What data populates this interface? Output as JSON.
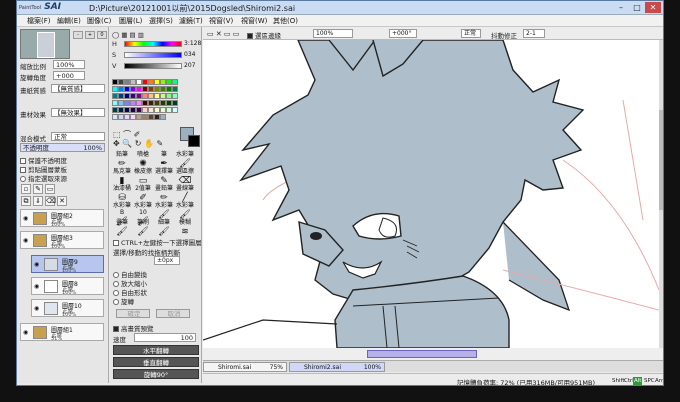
{
  "app": {
    "logo": "SAI",
    "logo_sub": "PaintTool",
    "title": "D:\\Picture\\20121001以前\\2015Dogsled\\Shiromi2.sai"
  },
  "window_controls": {
    "minimize": "–",
    "maximize": "□",
    "close": "✕"
  },
  "menu": [
    "檔案(F)",
    "編輯(E)",
    "圖像(C)",
    "圖層(L)",
    "選擇(S)",
    "濾鏡(T)",
    "視窗(V)",
    "視窗(W)",
    "其他(O)"
  ],
  "navigator": {
    "zoom_label": "縮放比例",
    "zoom_value": "100%",
    "angle_label": "旋轉角度",
    "angle_value": "+000",
    "btn_minus": "-",
    "btn_plus": "+",
    "btn_reset": "0"
  },
  "paper_texture": {
    "label": "畫紙質感",
    "value": "【無質感】"
  },
  "material_effect": {
    "label": "畫材效果",
    "value": "【無效果】"
  },
  "blend_mode": {
    "label": "混合模式",
    "value": "正常"
  },
  "opacity": {
    "label": "不透明度",
    "value": "100%"
  },
  "layer_options": [
    "保護不透明度",
    "剪貼圖層蒙板",
    "指定選取來源"
  ],
  "layers": [
    {
      "name": "圖層組2",
      "mode": "正常",
      "opacity": "100%",
      "folder": true
    },
    {
      "name": "圖層組3",
      "mode": "正常",
      "opacity": "100%",
      "folder": true
    },
    {
      "name": "圖層9",
      "mode": "正常",
      "opacity": "100%",
      "selected": true
    },
    {
      "name": "圖層8",
      "mode": "正常",
      "opacity": "100%"
    },
    {
      "name": "圖層10",
      "mode": "正常",
      "opacity": "100%"
    },
    {
      "name": "圖層組1",
      "mode": "正常",
      "opacity": "31%",
      "folder": true
    }
  ],
  "color_sliders": [
    {
      "label": "H",
      "value": "3:128"
    },
    {
      "label": "S",
      "value": "034"
    },
    {
      "label": "V",
      "value": "207"
    }
  ],
  "palette_colors": [
    "#000000",
    "#404040",
    "#808080",
    "#c0c0c0",
    "#ffffff",
    "#ff0000",
    "#ff8000",
    "#ffff00",
    "#80ff00",
    "#00ff00",
    "#00ff80",
    "#00ffff",
    "#0080ff",
    "#0000ff",
    "#8000ff",
    "#ff00ff",
    "#800000",
    "#804000",
    "#808000",
    "#408000",
    "#008000",
    "#008040",
    "#008080",
    "#004080",
    "#000080",
    "#400080",
    "#800080",
    "#ff8080",
    "#ffc080",
    "#ffff80",
    "#c0ff80",
    "#80ff80",
    "#80ffc0",
    "#80ffff",
    "#80c0ff",
    "#8080ff",
    "#c080ff",
    "#ff80ff",
    "#400000",
    "#402000",
    "#404000",
    "#204000",
    "#004000",
    "#004020",
    "#004040",
    "#002040",
    "#000040",
    "#200040",
    "#400040",
    "#ffd0d0",
    "#ffe8d0",
    "#fffcd0",
    "#e0ffd0",
    "#d0ffe0",
    "#d0ffff",
    "#d0e8ff",
    "#d0d0ff",
    "#e8d0ff",
    "#ffd0ff",
    "#c8a080",
    "#a08060",
    "#604030",
    "#302018",
    "#9cb0c0"
  ],
  "tools": [
    {
      "label": "鉛筆",
      "icon": "pencil-icon"
    },
    {
      "label": "噴槍",
      "icon": "airbrush-icon"
    },
    {
      "label": "筆",
      "icon": "pen-icon"
    },
    {
      "label": "水彩筆",
      "icon": "watercolor-icon"
    },
    {
      "label": "馬克筆",
      "icon": "marker-icon"
    },
    {
      "label": "橡皮擦",
      "icon": "eraser-icon"
    },
    {
      "label": "選擇筆",
      "icon": "select-pen-icon"
    },
    {
      "label": "選區擦",
      "icon": "select-eraser-icon"
    },
    {
      "label": "油漆桶",
      "icon": "bucket-icon"
    },
    {
      "label": "2值筆",
      "icon": "binary-pen-icon"
    },
    {
      "label": "畫鉛筆",
      "icon": "pencil2-icon"
    },
    {
      "label": "畫線筆",
      "icon": "line-pen-icon"
    },
    {
      "label": "水彩筆B",
      "icon": "brush-icon"
    },
    {
      "label": "水彩筆10",
      "icon": "brush-icon"
    },
    {
      "label": "水彩筆",
      "icon": "brush-icon"
    },
    {
      "label": "水彩筆",
      "icon": "brush-icon"
    },
    {
      "label": "畫筆",
      "icon": "brush-icon"
    },
    {
      "label": "筆刷",
      "icon": "brush-icon"
    },
    {
      "label": "細筆",
      "icon": "brush-icon"
    },
    {
      "label": "模糊",
      "icon": "blur-icon"
    }
  ],
  "tool_options": {
    "ctrl_select": "CTRL+左鍵按一下選擇圖層",
    "range_label": "選擇/移動的找拖柄判斷",
    "range_value": "±0px",
    "transform_modes": [
      "自由變換",
      "放大縮小",
      "自由形狀",
      "旋轉"
    ],
    "ok": "確定",
    "cancel": "取消",
    "hq_preview": "高畫質預覽",
    "speed_label": "速度",
    "speed_value": "100"
  },
  "bottom_buttons": [
    "水平翻轉",
    "垂直翻轉",
    "旋轉90°"
  ],
  "canvas_toolbar": {
    "fill_label": "選區邊緣",
    "zoom": "100%",
    "angle": "+000°",
    "mode": "正常",
    "stabilizer_label": "抖動修正",
    "stabilizer_value": "2-1"
  },
  "doc_tabs": [
    {
      "name": "Shiromi.sai",
      "pct": "75%"
    },
    {
      "name": "Shiromi2.sai",
      "pct": "100%",
      "selected": true
    }
  ],
  "status": {
    "memory": "記憶體負荷率: 72% (已用316MB/可用951MB)",
    "indicators": [
      "Shift",
      "Ctrl",
      "Alt",
      "SPC",
      "Any"
    ],
    "active_indicator": "Alt"
  }
}
